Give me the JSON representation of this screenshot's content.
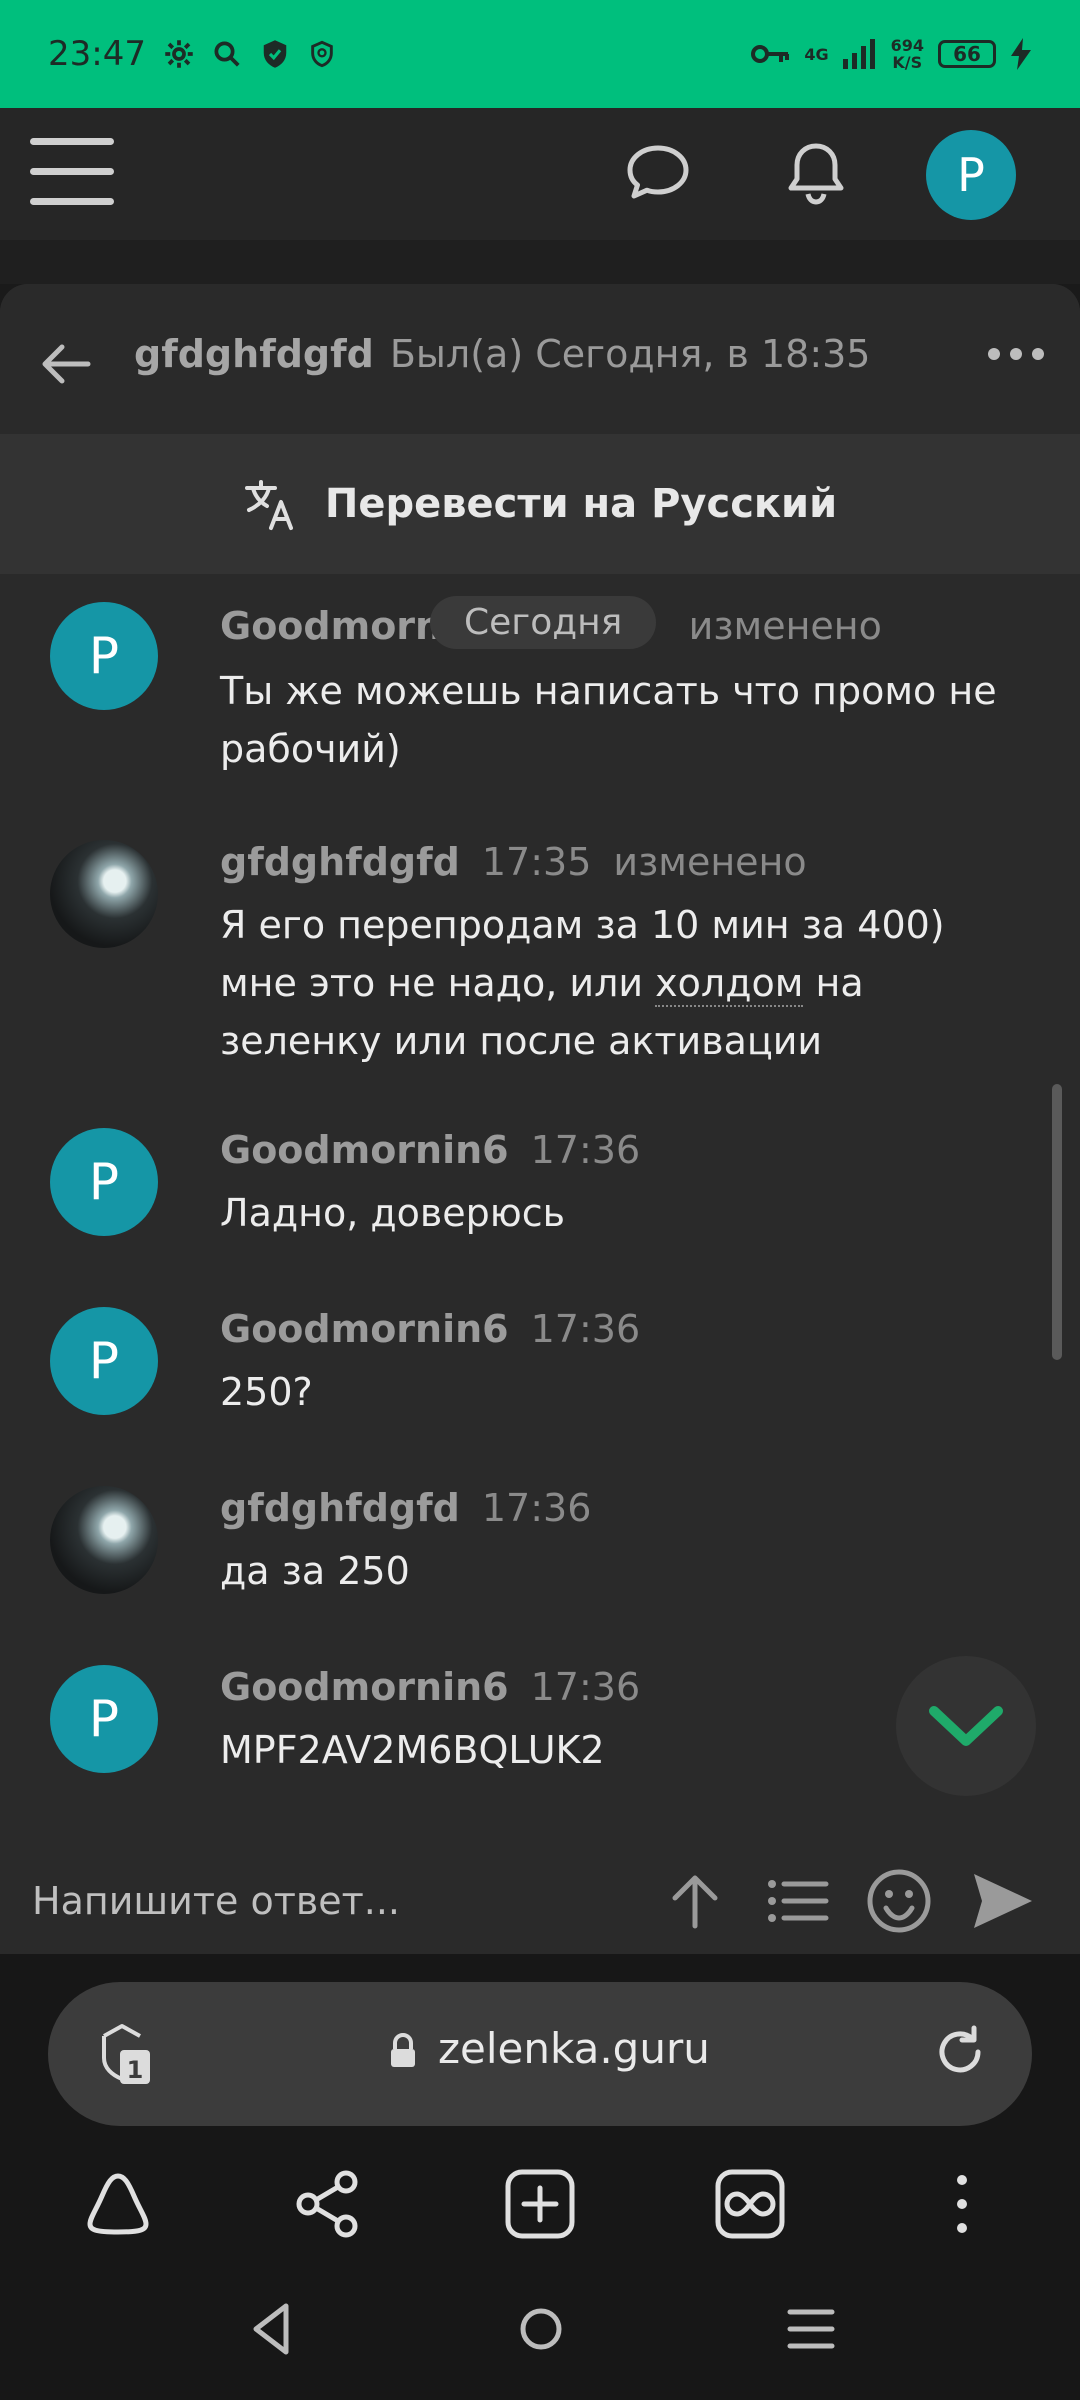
{
  "status_bar": {
    "time": "23:47",
    "network_top": "4G",
    "speed_value": "694",
    "speed_unit": "K/S",
    "battery": "66"
  },
  "header": {
    "avatar_letter": "P"
  },
  "chat": {
    "contact_name": "gfdghfdgfd",
    "last_seen": "Был(а) Сегодня, в 18:35",
    "translate_label": "Перевести на Русский",
    "date_pill": "Сегодня",
    "messages": [
      {
        "author": "Goodmornin6",
        "avatar": "P",
        "time": "",
        "edited": "изменено",
        "text": "Ты же можешь написать что промо не рабочий)"
      },
      {
        "author": "gfdghfdgfd",
        "avatar": "",
        "time": "17:35",
        "edited": "изменено",
        "text_a": "Я его перепродам за 10 мин за 400) мне это не надо, или ",
        "text_link": "холдом",
        "text_b": " на зеленку или после активации"
      },
      {
        "author": "Goodmornin6",
        "avatar": "P",
        "time": "17:36",
        "text": "Ладно, доверюсь"
      },
      {
        "author": "Goodmornin6",
        "avatar": "P",
        "time": "17:36",
        "text": "250?"
      },
      {
        "author": "gfdghfdgfd",
        "avatar": "",
        "time": "17:36",
        "text": "да за 250"
      },
      {
        "author": "Goodmornin6",
        "avatar": "P",
        "time": "17:36",
        "text": "MPF2AV2M6BQLUK2"
      }
    ],
    "reply_placeholder": "Напишите ответ..."
  },
  "browser": {
    "url": "zelenka.guru",
    "tab_count": "1"
  },
  "colors": {
    "status_bar": "#00bf7d",
    "avatar_teal": "#1596a6",
    "scroll_down_check": "#1faa6a"
  }
}
